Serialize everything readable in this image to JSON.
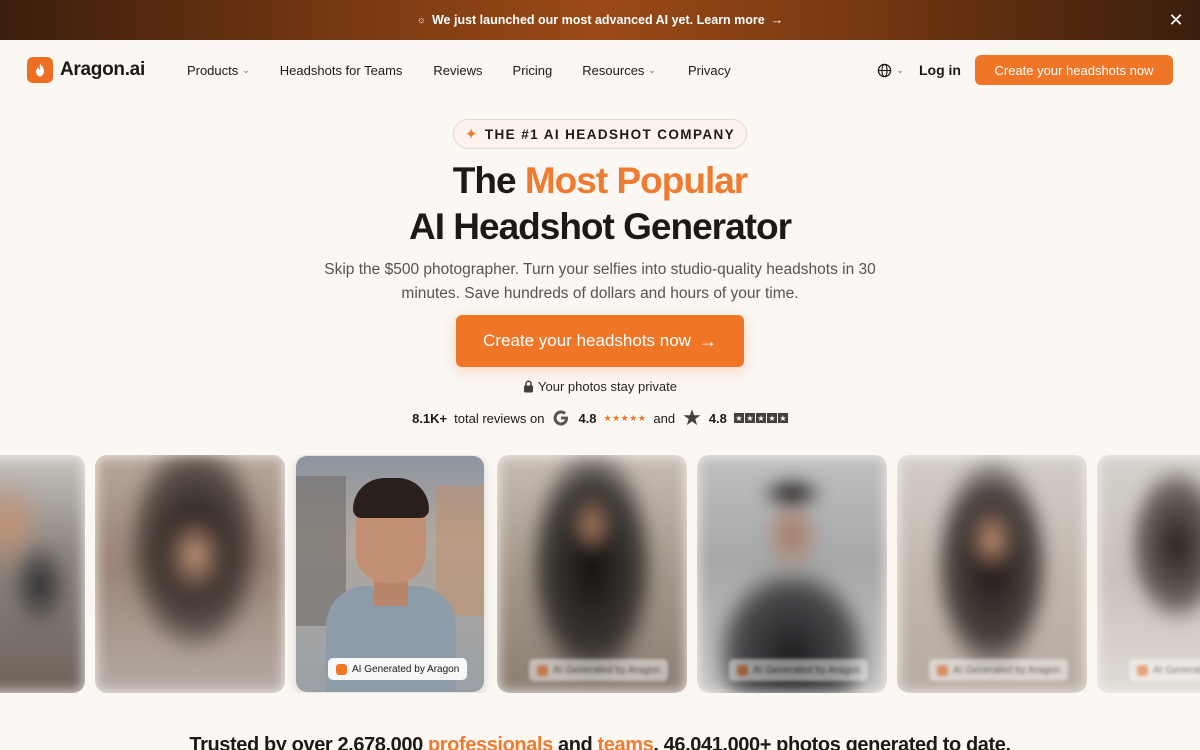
{
  "announcement": {
    "text": "We just launched our most advanced AI yet. Learn more",
    "close_icon": "close-icon"
  },
  "header": {
    "logo_text": "Aragon.ai",
    "nav": [
      {
        "label": "Products",
        "dropdown": true
      },
      {
        "label": "Headshots for Teams",
        "dropdown": false
      },
      {
        "label": "Reviews",
        "dropdown": false
      },
      {
        "label": "Pricing",
        "dropdown": false
      },
      {
        "label": "Resources",
        "dropdown": true
      },
      {
        "label": "Privacy",
        "dropdown": false
      }
    ],
    "login": "Log in",
    "cta": "Create your headshots now"
  },
  "hero": {
    "badge": "THE #1 AI HEADSHOT COMPANY",
    "headline_part1": "The ",
    "headline_accent": "Most Popular",
    "headline_line2": "AI Headshot Generator",
    "subtitle": "Skip the $500 photographer. Turn your selfies into studio-quality headshots in 30 minutes. Save hundreds of dollars and hours of your time.",
    "cta": "Create your headshots now",
    "private_note": "Your photos stay private",
    "reviews": {
      "count": "8.1K+",
      "text": "total reviews on",
      "google_rating": "4.8",
      "and": "and",
      "trustpilot_rating": "4.8"
    }
  },
  "gallery": {
    "label": "AI Generated by Aragon"
  },
  "trusted": {
    "part1": "Trusted by over 2,678,000 ",
    "professionals": "professionals",
    "and": " and ",
    "teams": "teams",
    "part2": ". 46,041,000+ photos generated to date."
  },
  "colors": {
    "accent": "#ef7527",
    "background": "#fbf7f3"
  }
}
